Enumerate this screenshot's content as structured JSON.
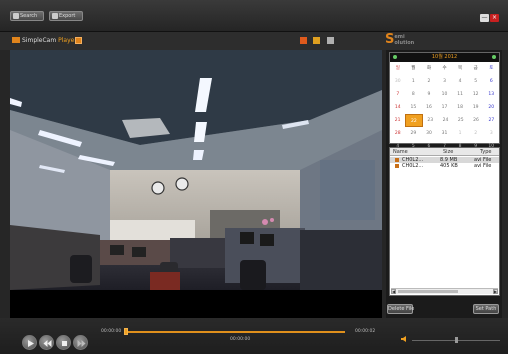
{
  "toolbar": {
    "search_label": "Search",
    "export_label": "Export"
  },
  "window": {
    "minimize_icon": "minimize-icon",
    "close_icon": "close-icon"
  },
  "brand": {
    "name_main": "SimpleCam ",
    "name_accent": "Player"
  },
  "logo": {
    "s": "S",
    "top": "emi",
    "bottom": "olution"
  },
  "calendar": {
    "title": "10월  2012",
    "weekdays": [
      "일",
      "월",
      "화",
      "수",
      "목",
      "금",
      "토"
    ],
    "weeks": [
      [
        "30",
        "1",
        "2",
        "3",
        "4",
        "5",
        "6"
      ],
      [
        "7",
        "8",
        "9",
        "10",
        "11",
        "12",
        "13"
      ],
      [
        "14",
        "15",
        "16",
        "17",
        "18",
        "19",
        "20"
      ],
      [
        "21",
        "22",
        "23",
        "24",
        "25",
        "26",
        "27"
      ],
      [
        "28",
        "29",
        "30",
        "31",
        "1",
        "2",
        "3"
      ],
      [
        "4",
        "5",
        "6",
        "7",
        "8",
        "9",
        "10"
      ]
    ],
    "selected": "22"
  },
  "files": {
    "columns": [
      "Name",
      "Size",
      "Type"
    ],
    "rows": [
      {
        "name": "CH0L2...",
        "size": "8.9 MB",
        "type": "avi File"
      },
      {
        "name": "CH0L2...",
        "size": "405 KB",
        "type": "avi File"
      }
    ]
  },
  "panel_buttons": {
    "delete": "Delete File",
    "set_path": "Set Path"
  },
  "playback": {
    "start_time": "00:00:00",
    "end_time": "00:00:02",
    "current_time": "00:00:00",
    "progress": 0.0,
    "volume": 0.5
  },
  "colors": {
    "accent": "#f0a020",
    "close": "#c82020"
  }
}
